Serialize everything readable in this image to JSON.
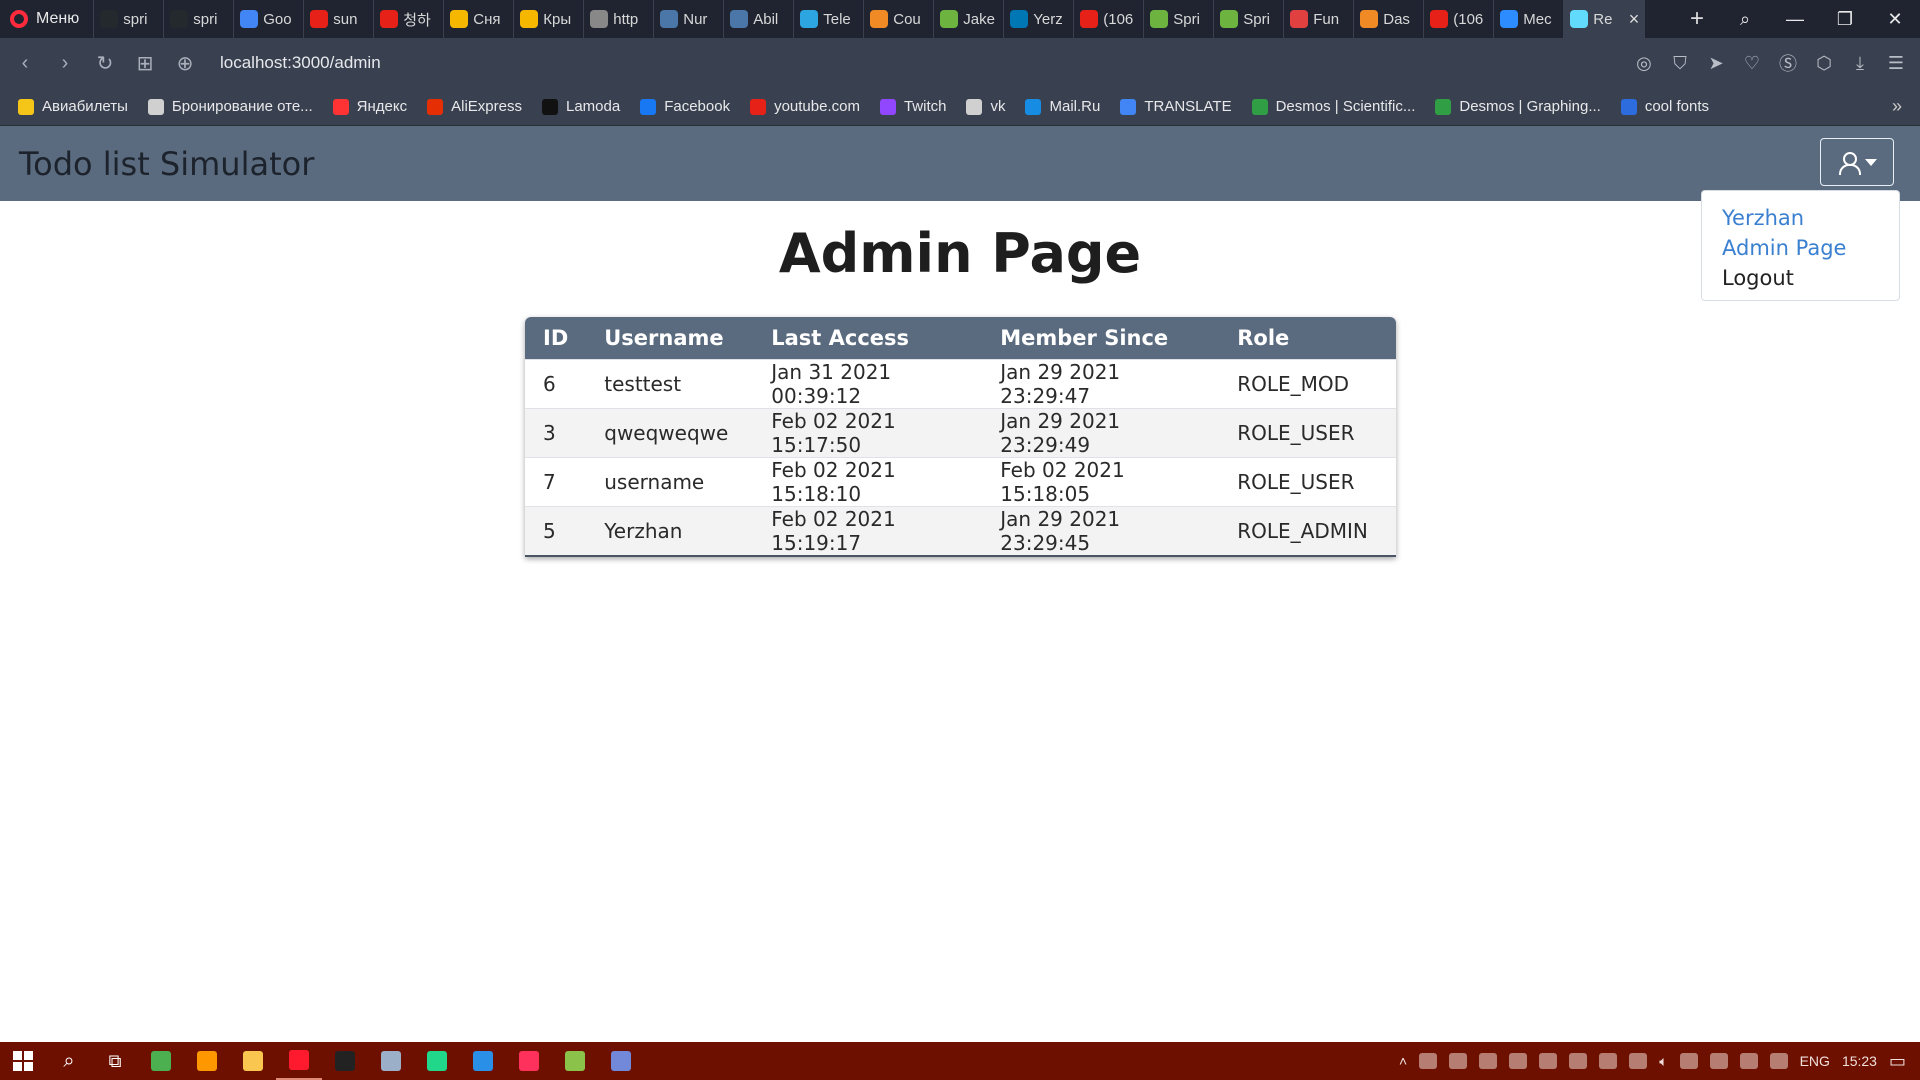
{
  "browser": {
    "menu_label": "Меню",
    "tabs": [
      {
        "label": "spri",
        "icon": "github-icon",
        "color": "#24292e"
      },
      {
        "label": "spri",
        "icon": "github-icon",
        "color": "#24292e"
      },
      {
        "label": "Goo",
        "icon": "google-translate-icon",
        "color": "#4285f4"
      },
      {
        "label": "sun",
        "icon": "youtube-icon",
        "color": "#e62117"
      },
      {
        "label": "청하",
        "icon": "youtube-icon",
        "color": "#e62117"
      },
      {
        "label": "Сня",
        "icon": "kinopoisk-icon",
        "color": "#f5b700"
      },
      {
        "label": "Кры",
        "icon": "kinopoisk-icon",
        "color": "#f5b700"
      },
      {
        "label": "http",
        "icon": "page-icon",
        "color": "#888888"
      },
      {
        "label": "Nur",
        "icon": "vk-icon",
        "color": "#4a76a8"
      },
      {
        "label": "Abil",
        "icon": "vk-icon",
        "color": "#4a76a8"
      },
      {
        "label": "Tele",
        "icon": "telegram-icon",
        "color": "#2ca5e0"
      },
      {
        "label": "Cou",
        "icon": "coursera-icon",
        "color": "#f08a24"
      },
      {
        "label": "Jake",
        "icon": "spring-icon",
        "color": "#6db33f"
      },
      {
        "label": "Yerz",
        "icon": "linkedin-icon",
        "color": "#0077b5"
      },
      {
        "label": "(106",
        "icon": "youtube-icon",
        "color": "#e62117"
      },
      {
        "label": "Spri",
        "icon": "spring-icon",
        "color": "#6db33f"
      },
      {
        "label": "Spri",
        "icon": "spring-icon",
        "color": "#6db33f"
      },
      {
        "label": "Fun",
        "icon": "app-icon",
        "color": "#e04040"
      },
      {
        "label": "Das",
        "icon": "coursera-icon",
        "color": "#f08a24"
      },
      {
        "label": "(106",
        "icon": "youtube-icon",
        "color": "#e62117"
      },
      {
        "label": "Mec",
        "icon": "chat-icon",
        "color": "#2d8cff"
      },
      {
        "label": "Re",
        "icon": "react-icon",
        "color": "#61dafb",
        "active": true
      }
    ],
    "url": "localhost:3000/admin",
    "bookmarks": [
      {
        "label": "Авиабилеты",
        "icon": "plane-icon",
        "color": "#f5c518"
      },
      {
        "label": "Бронирование оте...",
        "icon": "page-icon",
        "color": "#d0d0d0"
      },
      {
        "label": "Яндекс",
        "icon": "yandex-icon",
        "color": "#ff3333"
      },
      {
        "label": "AliExpress",
        "icon": "aliexpress-icon",
        "color": "#e62e04"
      },
      {
        "label": "Lamoda",
        "icon": "lamoda-icon",
        "color": "#111111"
      },
      {
        "label": "Facebook",
        "icon": "facebook-icon",
        "color": "#1877f2"
      },
      {
        "label": "youtube.com",
        "icon": "youtube-icon",
        "color": "#e62117"
      },
      {
        "label": "Twitch",
        "icon": "twitch-icon",
        "color": "#9146ff"
      },
      {
        "label": "vk",
        "icon": "page-icon",
        "color": "#d0d0d0"
      },
      {
        "label": "Mail.Ru",
        "icon": "mailru-icon",
        "color": "#168de2"
      },
      {
        "label": "TRANSLATE",
        "icon": "google-translate-icon",
        "color": "#4285f4"
      },
      {
        "label": "Desmos | Scientific...",
        "icon": "desmos-icon",
        "color": "#2f9e44"
      },
      {
        "label": "Desmos | Graphing...",
        "icon": "desmos-icon",
        "color": "#2f9e44"
      },
      {
        "label": "cool fonts",
        "icon": "c-icon",
        "color": "#2d6cdf"
      }
    ]
  },
  "app": {
    "brand": "Todo list Simulator",
    "user_menu": {
      "items": [
        {
          "label": "Yerzhan",
          "type": "link"
        },
        {
          "label": "Admin Page",
          "type": "link"
        },
        {
          "label": "Logout",
          "type": "plain"
        }
      ]
    },
    "page_title": "Admin Page",
    "table": {
      "columns": [
        "ID",
        "Username",
        "Last Access",
        "Member Since",
        "Role"
      ],
      "rows": [
        [
          "6",
          "testtest",
          "Jan 31 2021 00:39:12",
          "Jan 29 2021 23:29:47",
          "ROLE_MOD"
        ],
        [
          "3",
          "qweqweqwe",
          "Feb 02 2021 15:17:50",
          "Jan 29 2021 23:29:49",
          "ROLE_USER"
        ],
        [
          "7",
          "username",
          "Feb 02 2021 15:18:10",
          "Feb 02 2021 15:18:05",
          "ROLE_USER"
        ],
        [
          "5",
          "Yerzhan",
          "Feb 02 2021 15:19:17",
          "Jan 29 2021 23:29:45",
          "ROLE_ADMIN"
        ]
      ]
    }
  },
  "taskbar": {
    "apps": [
      {
        "icon": "chrome-icon",
        "color": "#4caf50"
      },
      {
        "icon": "sublime-icon",
        "color": "#ff9800"
      },
      {
        "icon": "folder-icon",
        "color": "#f9c74f"
      },
      {
        "icon": "opera-icon",
        "color": "#ff1b2d",
        "active": true
      },
      {
        "icon": "terminal-icon",
        "color": "#222222"
      },
      {
        "icon": "photos-icon",
        "color": "#9bb0c8"
      },
      {
        "icon": "pycharm-icon",
        "color": "#21d789"
      },
      {
        "icon": "vscode-icon",
        "color": "#2a8fe6"
      },
      {
        "icon": "intellij-icon",
        "color": "#fe315d"
      },
      {
        "icon": "notepad-icon",
        "color": "#8bc34a"
      },
      {
        "icon": "discord-icon",
        "color": "#7289da"
      }
    ],
    "language": "ENG",
    "time": "15:23"
  }
}
